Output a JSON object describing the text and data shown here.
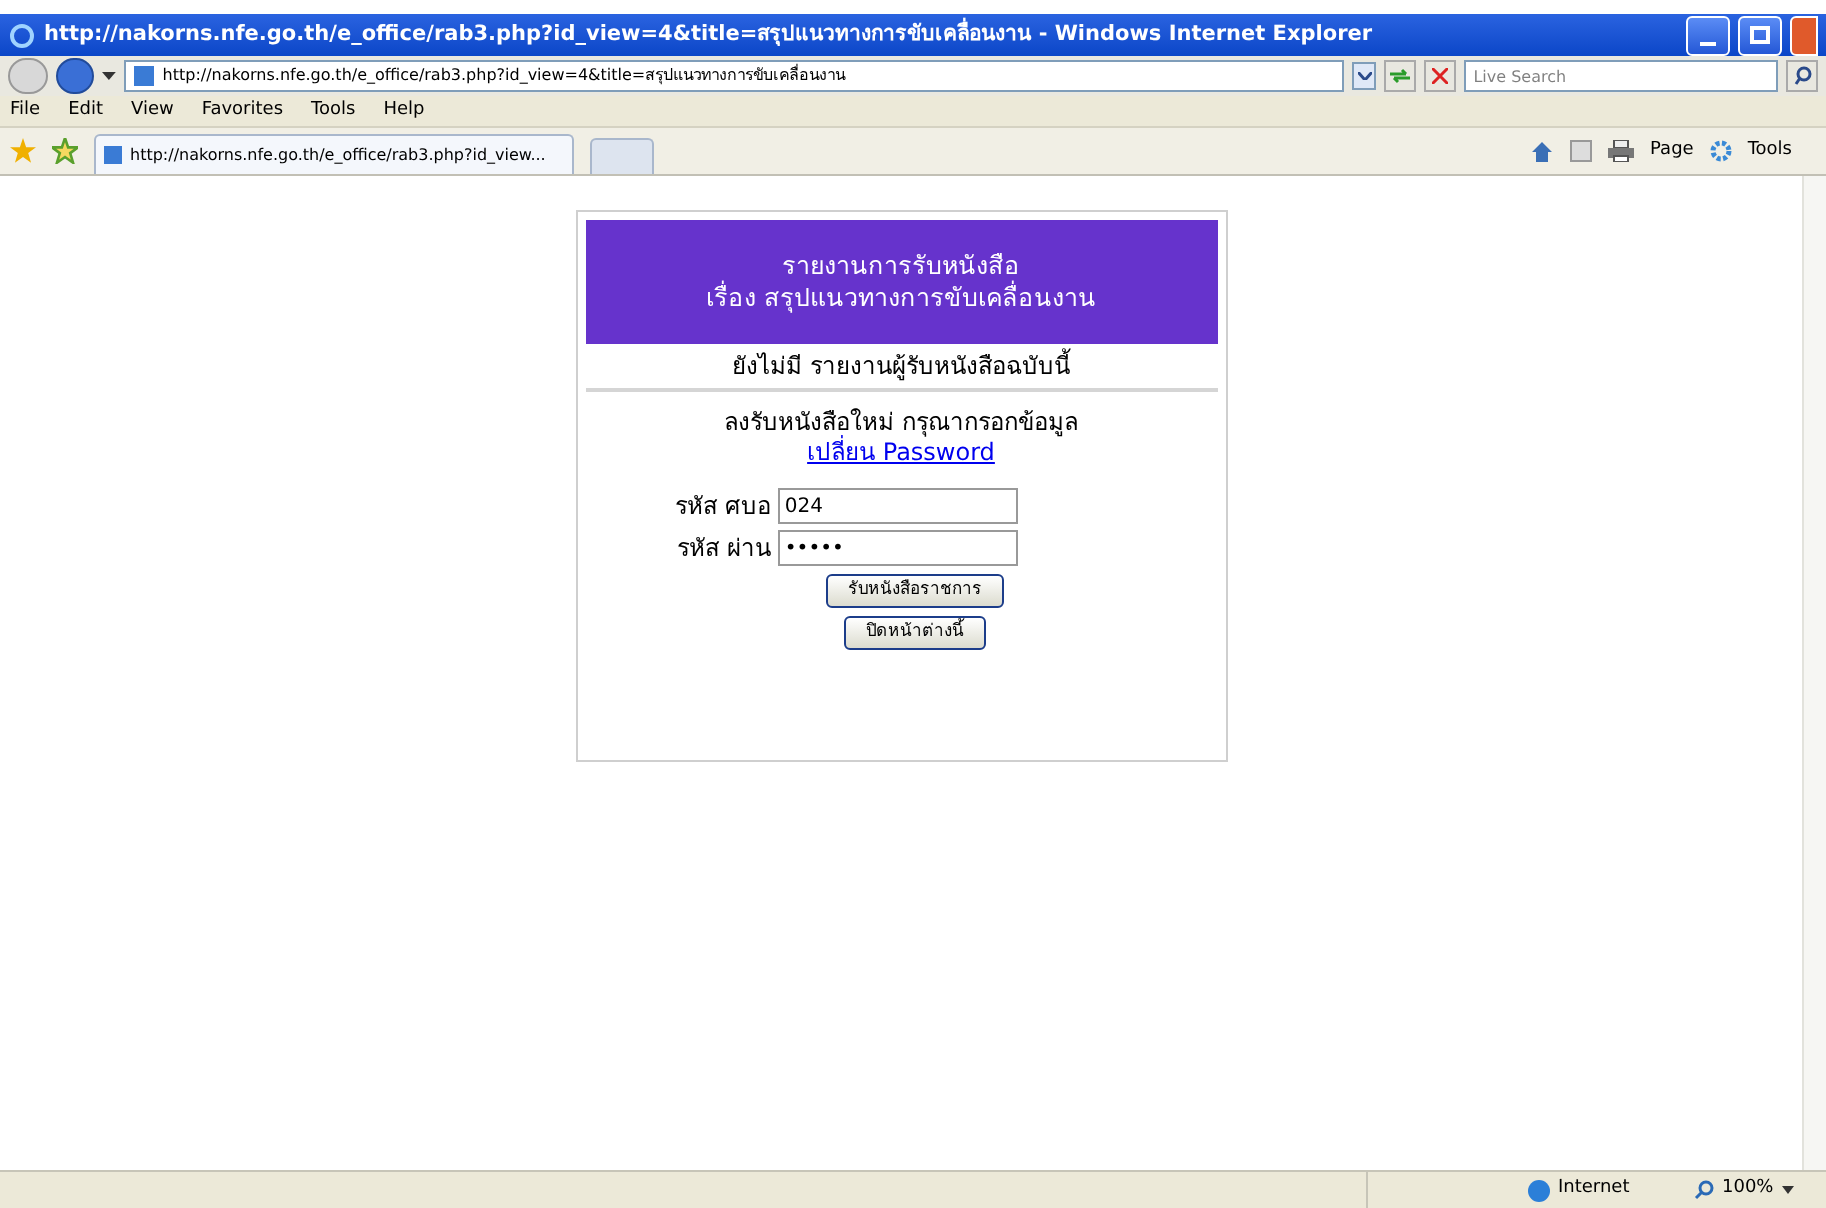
{
  "window": {
    "title": "http://nakorns.nfe.go.th/e_office/rab3.php?id_view=4&title=สรุปแนวทางการขับเคลื่อนงาน - Windows Internet Explorer"
  },
  "address_bar": {
    "url": "http://nakorns.nfe.go.th/e_office/rab3.php?id_view=4&title=สรุปแนวทางการขับเคลื่อนงาน",
    "search_placeholder": "Live Search"
  },
  "menu": [
    "File",
    "Edit",
    "View",
    "Favorites",
    "Tools",
    "Help"
  ],
  "tabs": [
    {
      "label": "http://nakorns.nfe.go.th/e_office/rab3.php?id_view...",
      "selected": true
    }
  ],
  "command_bar": {
    "page": "Page",
    "tools": "Tools"
  },
  "page": {
    "header_lines": [
      "รายงานการรับหนังสือ",
      "เรื่อง สรุปแนวทางการขับเคลื่อนงาน"
    ],
    "notice": "ยังไม่มี รายงานผู้รับหนังสือฉบับนี้",
    "instruction": "ลงรับหนังสือใหม่ กรุณากรอกข้อมูล",
    "link": "เปลี่ยน Password",
    "fields": [
      {
        "label": "รหัส ศบอ",
        "value": "024"
      },
      {
        "label": "รหัส ผ่าน",
        "value": "•••••"
      }
    ],
    "buttons": [
      "รับหนังสือราชการ",
      "ปิดหน้าต่างนี้"
    ]
  },
  "status_bar": {
    "zone": "Internet",
    "zoom": "100%"
  }
}
